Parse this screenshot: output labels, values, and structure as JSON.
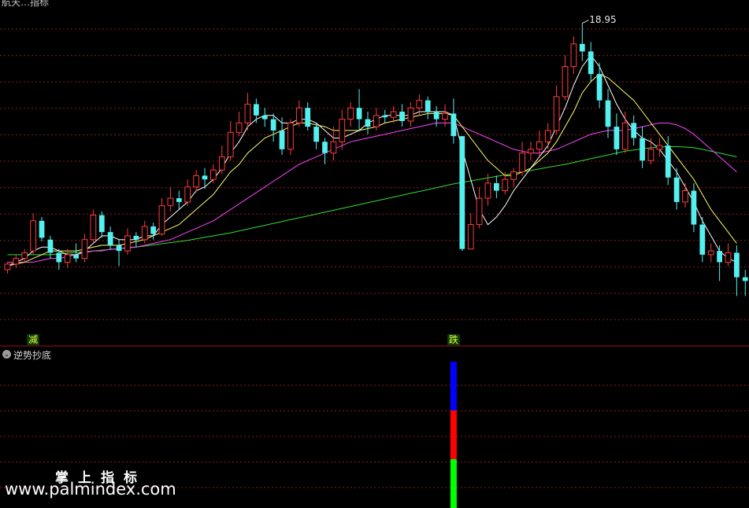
{
  "main_title": "航天…指标",
  "indicator_title": "逆势抄底",
  "watermark_cn": "掌上指标",
  "watermark_url": "www.palmindex.com",
  "colors": {
    "background": "#000000",
    "up": "#ff3b3b",
    "down": "#54f0f0",
    "grid": "#8b1a1a",
    "ma5": "#ffffff",
    "ma10": "#ffff66",
    "ma20": "#ff44ff",
    "ma60": "#33dd33",
    "bar_blue": "#0000ff",
    "bar_red": "#ff0000",
    "bar_green": "#00ff00"
  },
  "chart_data": [
    {
      "type": "candlestick",
      "title": "",
      "max_label": "18.95",
      "signal_tags": [
        {
          "text": "减",
          "at_candle": 3
        },
        {
          "text": "跌",
          "at_candle": 52
        }
      ],
      "ylim": [
        11.0,
        19.4
      ],
      "series_names": [],
      "candles": [
        [
          12.4,
          12.55,
          12.3,
          12.6
        ],
        [
          12.55,
          12.7,
          12.45,
          12.8
        ],
        [
          12.7,
          12.85,
          12.6,
          12.95
        ],
        [
          12.9,
          13.7,
          12.8,
          13.9
        ],
        [
          13.7,
          13.25,
          13.15,
          13.8
        ],
        [
          13.2,
          12.85,
          12.7,
          13.3
        ],
        [
          12.85,
          12.6,
          12.4,
          12.95
        ],
        [
          12.6,
          12.8,
          12.45,
          12.95
        ],
        [
          12.8,
          12.7,
          12.6,
          13.1
        ],
        [
          12.7,
          13.2,
          12.6,
          13.35
        ],
        [
          13.2,
          13.85,
          13.1,
          14.0
        ],
        [
          13.85,
          13.4,
          13.25,
          13.95
        ],
        [
          13.4,
          13.05,
          12.95,
          13.55
        ],
        [
          13.05,
          12.9,
          12.5,
          13.2
        ],
        [
          12.9,
          13.3,
          12.8,
          13.5
        ],
        [
          13.3,
          13.2,
          13.0,
          13.4
        ],
        [
          13.2,
          13.55,
          13.1,
          13.7
        ],
        [
          13.55,
          13.35,
          13.2,
          13.65
        ],
        [
          13.35,
          14.1,
          13.3,
          14.3
        ],
        [
          14.1,
          14.3,
          13.95,
          14.6
        ],
        [
          14.3,
          14.2,
          14.0,
          14.5
        ],
        [
          14.2,
          14.6,
          14.1,
          14.8
        ],
        [
          14.6,
          14.9,
          14.45,
          15.05
        ],
        [
          14.9,
          14.8,
          14.55,
          15.1
        ],
        [
          14.8,
          15.05,
          14.7,
          15.2
        ],
        [
          15.05,
          15.4,
          14.95,
          15.7
        ],
        [
          15.4,
          16.05,
          15.3,
          16.35
        ],
        [
          16.05,
          16.3,
          15.95,
          16.6
        ],
        [
          16.3,
          16.8,
          16.1,
          17.1
        ],
        [
          16.8,
          16.5,
          16.3,
          16.95
        ],
        [
          16.5,
          16.4,
          16.2,
          16.7
        ],
        [
          16.4,
          16.1,
          15.8,
          16.55
        ],
        [
          16.1,
          15.6,
          15.45,
          16.45
        ],
        [
          15.6,
          16.3,
          15.45,
          16.4
        ],
        [
          16.3,
          16.7,
          16.2,
          16.9
        ],
        [
          16.7,
          16.2,
          16.1,
          16.85
        ],
        [
          16.2,
          15.8,
          15.6,
          16.3
        ],
        [
          15.8,
          15.5,
          15.2,
          15.9
        ],
        [
          15.5,
          15.8,
          15.3,
          16.2
        ],
        [
          15.8,
          16.4,
          15.6,
          16.65
        ],
        [
          16.4,
          16.7,
          16.2,
          16.85
        ],
        [
          16.7,
          16.4,
          16.1,
          17.2
        ],
        [
          16.4,
          16.2,
          16.0,
          16.6
        ],
        [
          16.2,
          16.5,
          16.1,
          16.7
        ],
        [
          16.5,
          16.45,
          16.3,
          16.65
        ],
        [
          16.45,
          16.6,
          16.3,
          16.75
        ],
        [
          16.6,
          16.35,
          16.2,
          16.8
        ],
        [
          16.35,
          16.7,
          16.2,
          16.85
        ],
        [
          16.7,
          16.9,
          16.5,
          17.05
        ],
        [
          16.9,
          16.6,
          16.4,
          17.0
        ],
        [
          16.6,
          16.4,
          16.2,
          16.75
        ],
        [
          16.4,
          16.55,
          16.2,
          16.8
        ],
        [
          16.55,
          15.95,
          15.75,
          16.95
        ],
        [
          15.95,
          12.95,
          12.9,
          14.1
        ],
        [
          12.95,
          13.6,
          12.95,
          13.9
        ],
        [
          13.6,
          14.3,
          13.5,
          14.6
        ],
        [
          14.3,
          14.7,
          14.1,
          14.95
        ],
        [
          14.7,
          14.5,
          14.3,
          14.9
        ],
        [
          14.5,
          14.8,
          14.4,
          15.0
        ],
        [
          14.8,
          15.0,
          14.6,
          15.1
        ],
        [
          15.0,
          15.5,
          14.9,
          15.8
        ],
        [
          15.5,
          15.6,
          15.3,
          15.8
        ],
        [
          15.6,
          15.8,
          15.4,
          16.1
        ],
        [
          15.8,
          16.1,
          15.6,
          16.3
        ],
        [
          16.1,
          17.0,
          16.0,
          17.3
        ],
        [
          17.0,
          17.8,
          16.9,
          18.1
        ],
        [
          17.8,
          18.4,
          17.6,
          18.6
        ],
        [
          18.4,
          18.2,
          17.95,
          18.95
        ],
        [
          18.2,
          17.6,
          17.4,
          18.45
        ],
        [
          17.6,
          16.9,
          16.7,
          17.9
        ],
        [
          16.9,
          16.2,
          15.9,
          17.2
        ],
        [
          16.2,
          15.6,
          15.45,
          16.55
        ],
        [
          15.6,
          16.3,
          15.5,
          16.6
        ],
        [
          16.3,
          15.9,
          15.7,
          16.5
        ],
        [
          15.9,
          15.3,
          15.1,
          16.2
        ],
        [
          15.3,
          15.6,
          15.2,
          15.9
        ],
        [
          15.6,
          15.7,
          15.4,
          15.9
        ],
        [
          15.7,
          14.85,
          14.65,
          15.95
        ],
        [
          14.85,
          14.2,
          14.0,
          15.1
        ],
        [
          14.2,
          14.5,
          14.05,
          14.7
        ],
        [
          14.5,
          13.6,
          13.4,
          14.7
        ],
        [
          13.6,
          12.8,
          12.6,
          13.8
        ],
        [
          12.8,
          12.9,
          12.6,
          13.1
        ],
        [
          12.9,
          12.6,
          12.1,
          13.05
        ],
        [
          12.6,
          12.85,
          12.5,
          13.1
        ],
        [
          12.85,
          12.2,
          11.7,
          13.05
        ],
        [
          12.2,
          12.1,
          11.7,
          12.4
        ]
      ],
      "ma5": [
        12.5,
        12.6,
        12.7,
        12.9,
        13.0,
        13.0,
        12.9,
        12.8,
        12.8,
        12.9,
        13.1,
        13.3,
        13.3,
        13.2,
        13.2,
        13.2,
        13.3,
        13.3,
        13.6,
        13.8,
        14.0,
        14.2,
        14.5,
        14.6,
        14.8,
        15.1,
        15.5,
        15.8,
        16.2,
        16.4,
        16.5,
        16.5,
        16.3,
        16.3,
        16.4,
        16.4,
        16.3,
        16.1,
        15.9,
        15.9,
        16.0,
        16.1,
        16.3,
        16.4,
        16.5,
        16.5,
        16.5,
        16.5,
        16.6,
        16.6,
        16.6,
        16.6,
        16.5,
        15.6,
        14.8,
        14.0,
        13.6,
        13.8,
        14.1,
        14.5,
        14.8,
        15.1,
        15.4,
        15.7,
        16.2,
        16.7,
        17.3,
        17.8,
        18.1,
        17.8,
        17.3,
        16.8,
        16.4,
        16.1,
        15.9,
        15.8,
        15.6,
        15.3,
        15.0,
        14.6,
        14.2,
        13.7,
        13.3,
        12.9,
        12.7,
        12.6
      ],
      "ma10": [
        12.5,
        12.55,
        12.6,
        12.7,
        12.8,
        12.9,
        12.9,
        12.9,
        12.9,
        12.95,
        13.0,
        13.05,
        13.05,
        13.05,
        13.1,
        13.15,
        13.2,
        13.3,
        13.4,
        13.5,
        13.6,
        13.8,
        14.0,
        14.2,
        14.4,
        14.7,
        15.0,
        15.2,
        15.5,
        15.7,
        15.9,
        16.0,
        16.1,
        16.2,
        16.3,
        16.3,
        16.25,
        16.2,
        16.1,
        16.1,
        16.1,
        16.1,
        16.15,
        16.2,
        16.3,
        16.35,
        16.4,
        16.45,
        16.5,
        16.55,
        16.55,
        16.55,
        16.5,
        16.2,
        15.9,
        15.6,
        15.3,
        15.1,
        14.9,
        14.9,
        15.0,
        15.1,
        15.3,
        15.5,
        15.8,
        16.2,
        16.6,
        17.1,
        17.4,
        17.6,
        17.5,
        17.3,
        17.1,
        16.9,
        16.6,
        16.3,
        16.0,
        15.7,
        15.4,
        15.1,
        14.8,
        14.4,
        14.0,
        13.7,
        13.4,
        13.1
      ],
      "ma20": [
        12.6,
        12.6,
        12.6,
        12.6,
        12.65,
        12.7,
        12.7,
        12.75,
        12.8,
        12.85,
        12.9,
        12.9,
        12.95,
        12.95,
        13.0,
        13.0,
        13.05,
        13.1,
        13.15,
        13.2,
        13.3,
        13.4,
        13.5,
        13.6,
        13.7,
        13.85,
        14.0,
        14.15,
        14.3,
        14.45,
        14.6,
        14.75,
        14.9,
        15.05,
        15.2,
        15.3,
        15.4,
        15.5,
        15.6,
        15.7,
        15.8,
        15.85,
        15.9,
        15.95,
        16.0,
        16.05,
        16.1,
        16.15,
        16.2,
        16.25,
        16.3,
        16.3,
        16.3,
        16.2,
        16.1,
        16.0,
        15.9,
        15.8,
        15.7,
        15.6,
        15.55,
        15.5,
        15.5,
        15.55,
        15.6,
        15.7,
        15.8,
        15.9,
        16.0,
        16.05,
        16.1,
        16.1,
        16.1,
        16.15,
        16.2,
        16.25,
        16.3,
        16.3,
        16.25,
        16.15,
        16.0,
        15.8,
        15.6,
        15.4,
        15.2,
        15.0
      ],
      "ma60": [
        12.8,
        12.8,
        12.8,
        12.8,
        12.8,
        12.8,
        12.82,
        12.84,
        12.86,
        12.88,
        12.9,
        12.92,
        12.94,
        12.96,
        12.98,
        13.0,
        13.03,
        13.06,
        13.09,
        13.12,
        13.15,
        13.18,
        13.22,
        13.26,
        13.3,
        13.34,
        13.38,
        13.43,
        13.48,
        13.53,
        13.58,
        13.63,
        13.68,
        13.73,
        13.78,
        13.83,
        13.88,
        13.93,
        13.98,
        14.03,
        14.08,
        14.13,
        14.18,
        14.23,
        14.28,
        14.33,
        14.38,
        14.43,
        14.48,
        14.53,
        14.58,
        14.63,
        14.68,
        14.72,
        14.76,
        14.8,
        14.84,
        14.88,
        14.92,
        14.96,
        15.0,
        15.04,
        15.08,
        15.12,
        15.16,
        15.2,
        15.25,
        15.3,
        15.35,
        15.4,
        15.45,
        15.5,
        15.55,
        15.58,
        15.61,
        15.64,
        15.66,
        15.67,
        15.67,
        15.66,
        15.64,
        15.6,
        15.55,
        15.5,
        15.45,
        15.4
      ]
    },
    {
      "type": "bar",
      "title": "",
      "note": "single stacked signal bar at the 跌 candle",
      "at_candle": 52,
      "segments": [
        {
          "color": "bar_green",
          "value": 1
        },
        {
          "color": "bar_red",
          "value": 1
        },
        {
          "color": "bar_blue",
          "value": 1
        }
      ]
    }
  ]
}
